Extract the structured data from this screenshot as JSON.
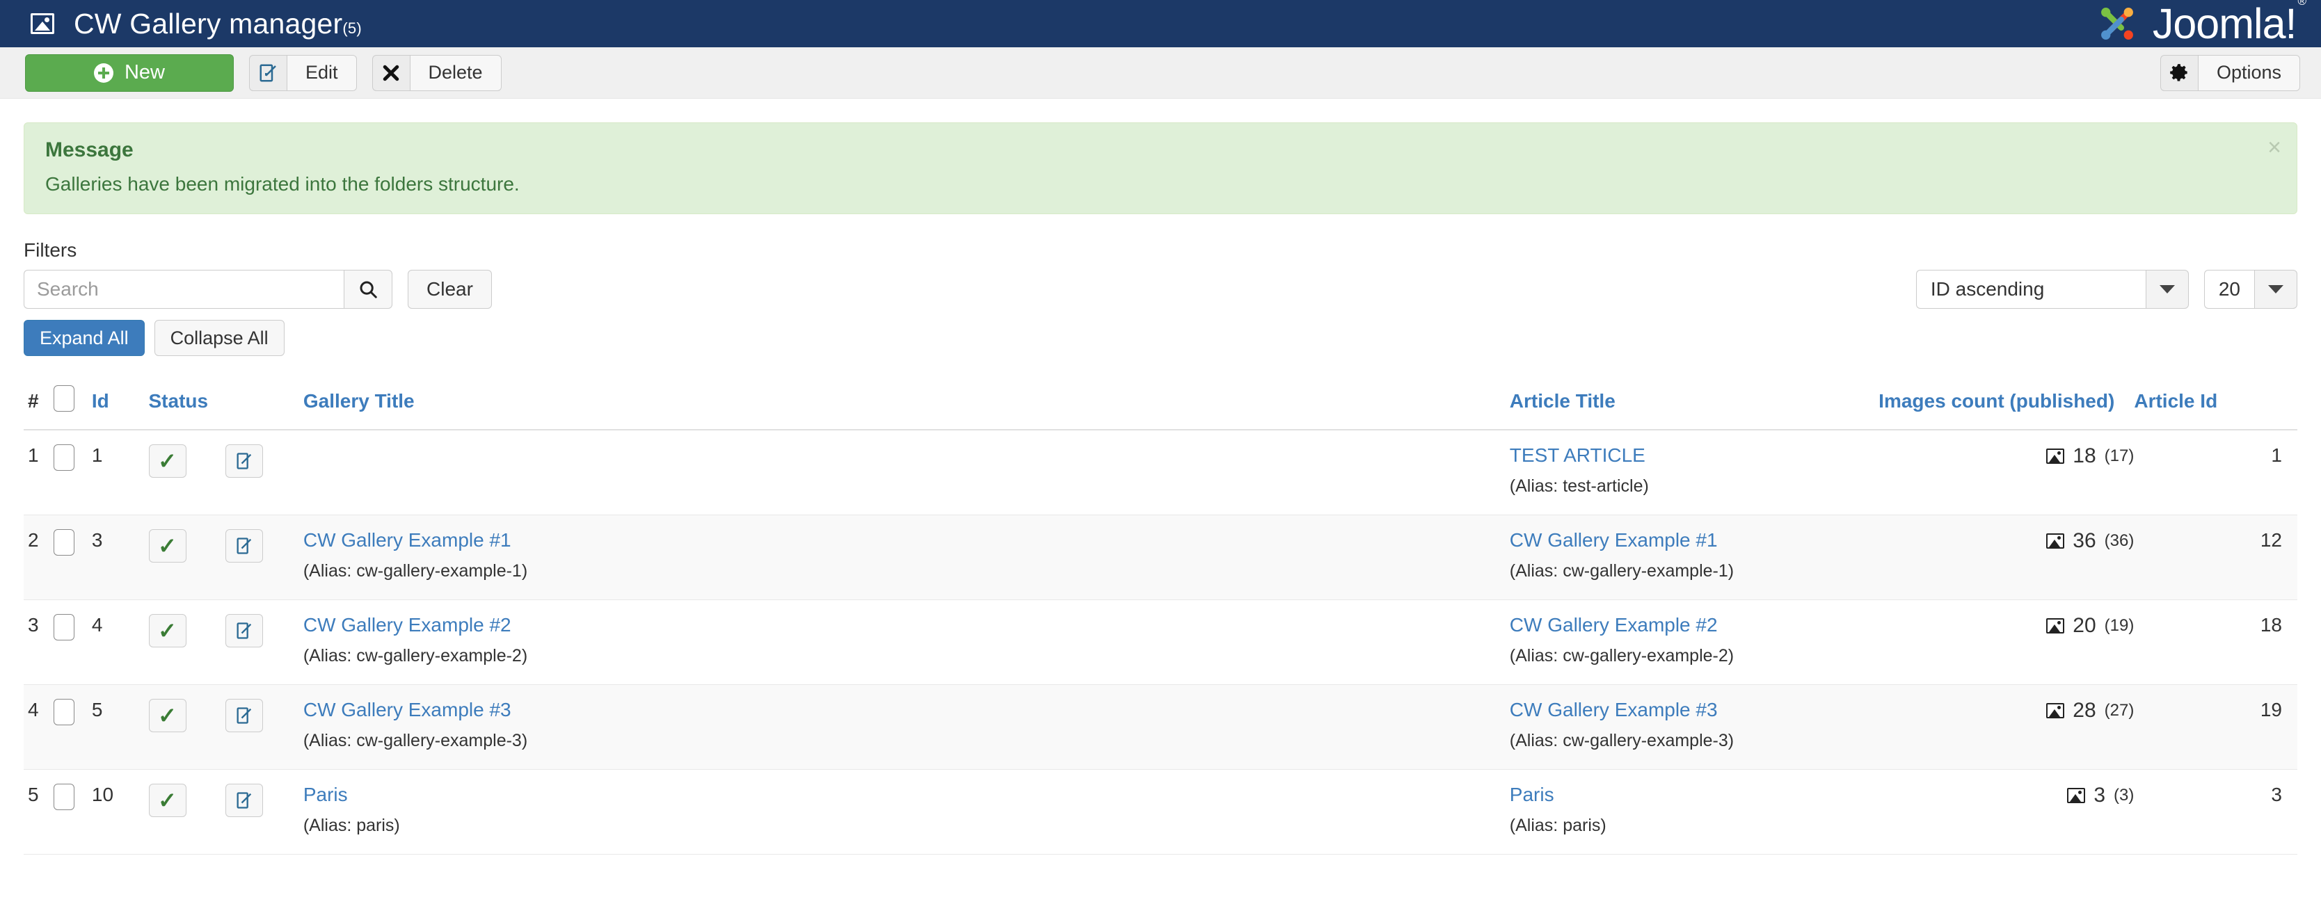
{
  "header": {
    "title": "CW Gallery manager",
    "count": "(5)",
    "icon": "image-icon",
    "brand": "Joomla!",
    "brand_mark": "®",
    "bg_color": "#1c3967"
  },
  "toolbar": {
    "new_label": "New",
    "edit_label": "Edit",
    "delete_label": "Delete",
    "options_label": "Options",
    "new_color": "#5bab4f"
  },
  "alert": {
    "title": "Message",
    "body": "Galleries have been migrated into the folders structure.",
    "close": "×",
    "bg_color": "#dff0d8",
    "text_color": "#3c763d"
  },
  "filters": {
    "label": "Filters",
    "search_value": "",
    "search_placeholder": "Search",
    "clear_label": "Clear",
    "expand_all_label": "Expand All",
    "collapse_all_label": "Collapse All",
    "sort_value": "ID ascending",
    "limit_value": "20"
  },
  "table": {
    "headers": {
      "num": "#",
      "id": "Id",
      "status": "Status",
      "gallery_title": "Gallery Title",
      "article_title": "Article Title",
      "images_count": "Images count (published)",
      "article_id": "Article Id"
    },
    "rows": [
      {
        "num": "1",
        "id": "1",
        "gallery_title": "",
        "gallery_alias": "",
        "article_title": "TEST ARTICLE",
        "article_alias": "(Alias: test-article)",
        "images": "18",
        "images_published": "(17)",
        "article_id": "1"
      },
      {
        "num": "2",
        "id": "3",
        "gallery_title": "CW Gallery Example #1",
        "gallery_alias": "(Alias: cw-gallery-example-1)",
        "article_title": "CW Gallery Example #1",
        "article_alias": "(Alias: cw-gallery-example-1)",
        "images": "36",
        "images_published": "(36)",
        "article_id": "12"
      },
      {
        "num": "3",
        "id": "4",
        "gallery_title": "CW Gallery Example #2",
        "gallery_alias": "(Alias: cw-gallery-example-2)",
        "article_title": "CW Gallery Example #2",
        "article_alias": "(Alias: cw-gallery-example-2)",
        "images": "20",
        "images_published": "(19)",
        "article_id": "18"
      },
      {
        "num": "4",
        "id": "5",
        "gallery_title": "CW Gallery Example #3",
        "gallery_alias": "(Alias: cw-gallery-example-3)",
        "article_title": "CW Gallery Example #3",
        "article_alias": "(Alias: cw-gallery-example-3)",
        "images": "28",
        "images_published": "(27)",
        "article_id": "19"
      },
      {
        "num": "5",
        "id": "10",
        "gallery_title": "Paris",
        "gallery_alias": "(Alias: paris)",
        "article_title": "Paris",
        "article_alias": "(Alias: paris)",
        "images": "3",
        "images_published": "(3)",
        "article_id": "3"
      }
    ]
  }
}
